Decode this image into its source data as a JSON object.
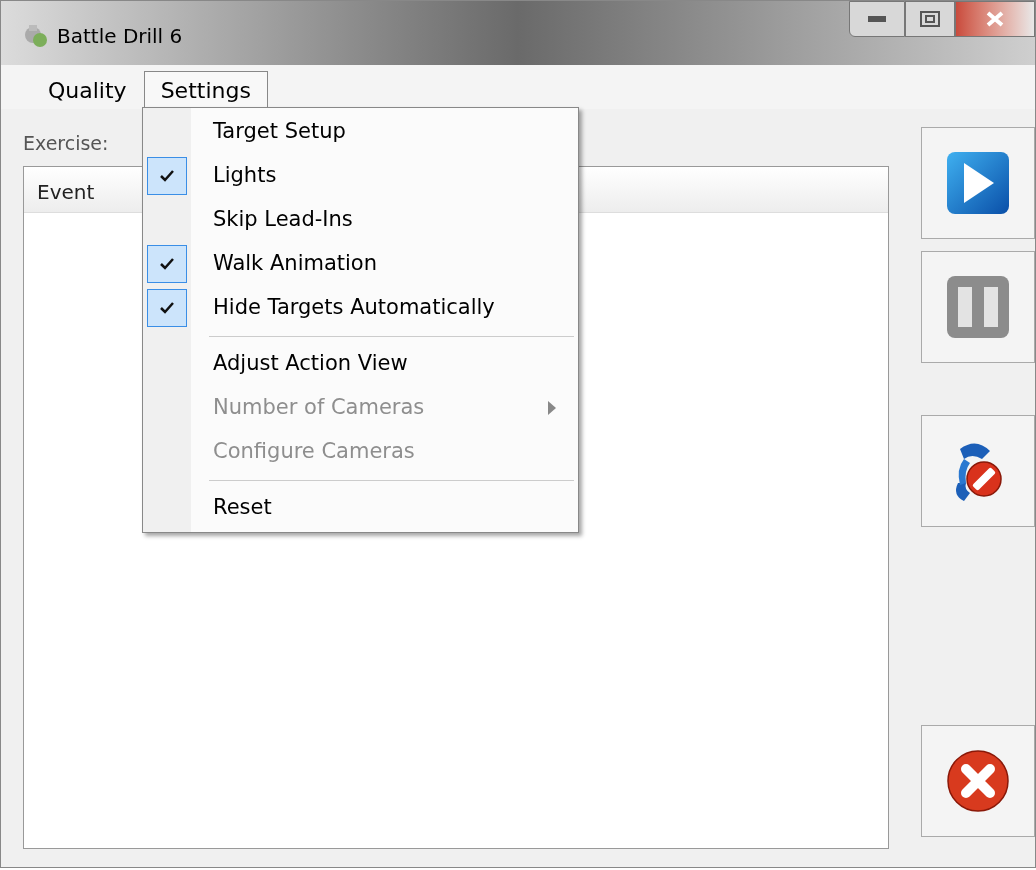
{
  "window": {
    "title": "Battle Drill 6"
  },
  "menu_bar": [
    {
      "label": "Quality",
      "selected": false
    },
    {
      "label": "Settings",
      "selected": true
    }
  ],
  "exercise_label": "Exercise:",
  "event_list": {
    "columns": [
      "Event"
    ]
  },
  "settings_menu": [
    {
      "kind": "item",
      "label": "Target Setup",
      "checked": false,
      "disabled": false
    },
    {
      "kind": "item",
      "label": "Lights",
      "checked": true,
      "disabled": false
    },
    {
      "kind": "item",
      "label": "Skip Lead-Ins",
      "checked": false,
      "disabled": false
    },
    {
      "kind": "item",
      "label": "Walk Animation",
      "checked": true,
      "disabled": false
    },
    {
      "kind": "item",
      "label": "Hide Targets Automatically",
      "checked": true,
      "disabled": false
    },
    {
      "kind": "separator"
    },
    {
      "kind": "item",
      "label": "Adjust Action View",
      "checked": false,
      "disabled": false
    },
    {
      "kind": "submenu",
      "label": "Number of Cameras",
      "checked": false,
      "disabled": true
    },
    {
      "kind": "item",
      "label": "Configure Cameras",
      "checked": false,
      "disabled": true
    },
    {
      "kind": "separator"
    },
    {
      "kind": "item",
      "label": "Reset",
      "checked": false,
      "disabled": false
    }
  ],
  "side_buttons": [
    {
      "kind": "play",
      "disabled": false
    },
    {
      "kind": "pause",
      "disabled": true
    },
    {
      "kind": "blocked",
      "disabled": false
    },
    {
      "kind": "cancel",
      "disabled": false
    }
  ]
}
